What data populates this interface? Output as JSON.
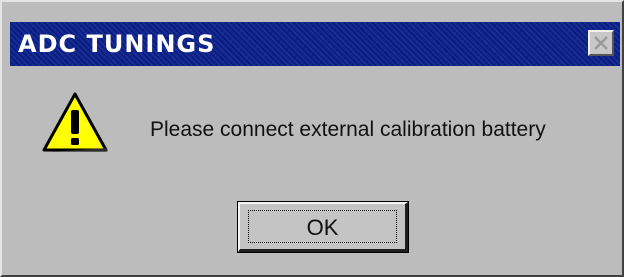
{
  "dialog": {
    "title": "ADC  TUNINGS",
    "message": "Please connect external calibration battery",
    "ok_label": "OK",
    "icon": "warning-icon",
    "close_icon": "close-icon"
  },
  "colors": {
    "titlebar": "#0a1f8a",
    "face": "#bcbcbc",
    "warning_fill": "#ffff00"
  }
}
